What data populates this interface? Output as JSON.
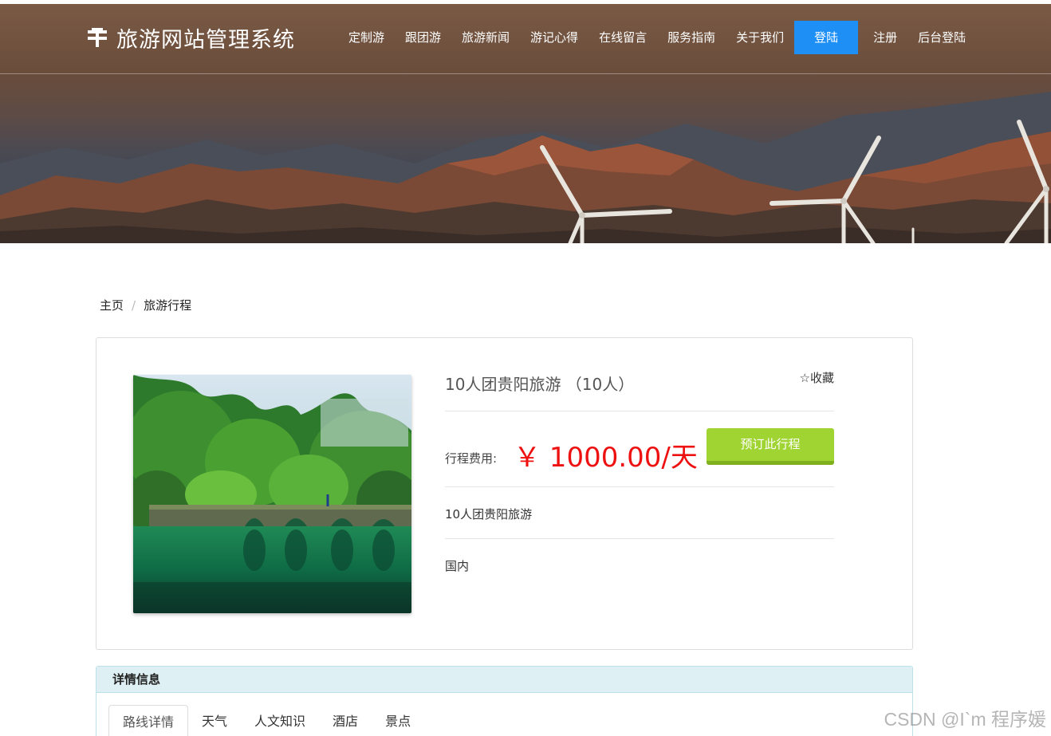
{
  "header": {
    "brand_title": "旅游网站管理系统",
    "brand_icon": "logo-icon",
    "nav_items": [
      {
        "label": "定制游"
      },
      {
        "label": "跟团游"
      },
      {
        "label": "旅游新闻"
      },
      {
        "label": "游记心得"
      },
      {
        "label": "在线留言"
      },
      {
        "label": "服务指南"
      },
      {
        "label": "关于我们"
      }
    ],
    "login_label": "登陆",
    "register_label": "注册",
    "admin_login_label": "后台登陆",
    "accent_color": "#1e8ff5"
  },
  "breadcrumb": {
    "home": "主页",
    "separator": "/",
    "current": "旅游行程"
  },
  "product": {
    "title": "10人团贵阳旅游  （10人）",
    "favorite_label": "☆收藏",
    "price_label": "行程费用:",
    "price_value": "￥  1000.00/天",
    "price_color": "#ee1111",
    "book_button_label": "预订此行程",
    "book_button_color": "#a0d433",
    "description": "10人团贵阳旅游",
    "region": "国内"
  },
  "details": {
    "heading": "详情信息",
    "tabs": [
      {
        "label": "路线详情",
        "active": true
      },
      {
        "label": "天气",
        "active": false
      },
      {
        "label": "人文知识",
        "active": false
      },
      {
        "label": "酒店",
        "active": false
      },
      {
        "label": "景点",
        "active": false
      }
    ]
  },
  "watermark": "CSDN @I`m 程序媛"
}
